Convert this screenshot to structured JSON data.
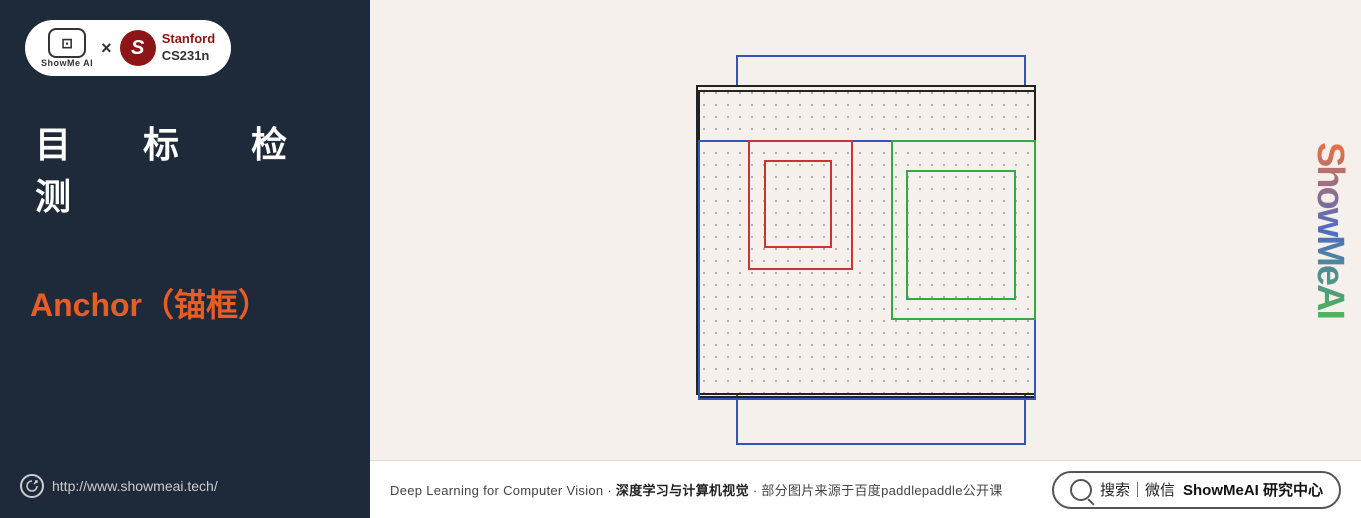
{
  "sidebar": {
    "logo": {
      "showmeai_text": "ShowMe Al",
      "cross": "×",
      "stanford_s": "S",
      "stanford_name": "Stanford",
      "stanford_course": "CS231n"
    },
    "title_chinese": "目　标　检　测",
    "anchor_title": "Anchor（锚框）",
    "website": "http://www.showmeai.tech/"
  },
  "watermark": {
    "text": "ShowMeAI"
  },
  "bottom": {
    "text_left": "Deep Learning for Computer Vision · 深度学习与计算机视觉 · 部分图片来源于百度paddlepaddle公开课",
    "search_text": "搜索｜微信",
    "search_label": "ShowMeAI 研究中心"
  }
}
